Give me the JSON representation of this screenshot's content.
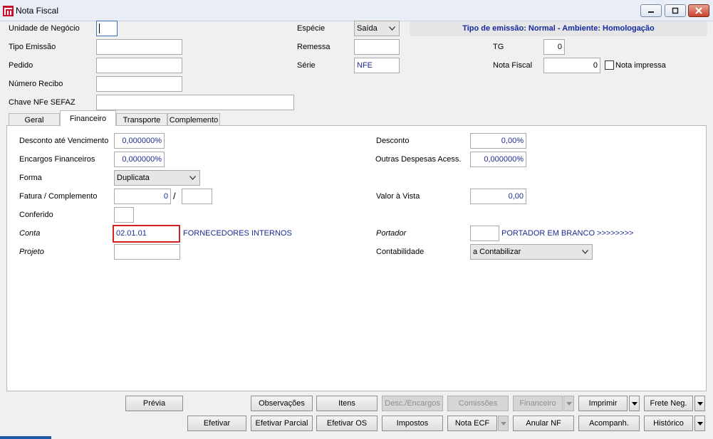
{
  "window": {
    "title": "Nota Fiscal"
  },
  "header": {
    "unidade_label": "Unidade de Negócio",
    "unidade_value": "",
    "tipo_emissao_label": "Tipo Emissão",
    "tipo_emissao_value": "",
    "pedido_label": "Pedido",
    "pedido_value": "",
    "numero_recibo_label": "Número Recibo",
    "numero_recibo_value": "",
    "chave_label": "Chave NFe SEFAZ",
    "chave_value": "",
    "especie_label": "Espécie",
    "especie_value": "Saída",
    "remessa_label": "Remessa",
    "remessa_value": "",
    "serie_label": "Série",
    "serie_value": "NFE",
    "banner": "Tipo de emissão: Normal - Ambiente: Homologação",
    "tg_label": "TG",
    "tg_value": "0",
    "nota_fiscal_label": "Nota Fiscal",
    "nota_fiscal_value": "0",
    "nota_impressa_label": "Nota impressa",
    "nota_impressa_checked": false
  },
  "tabs": [
    {
      "label": "Geral",
      "active": false
    },
    {
      "label": "Financeiro",
      "active": true
    },
    {
      "label": "Transporte",
      "active": false
    },
    {
      "label": "Complemento",
      "active": false
    }
  ],
  "financeiro": {
    "desconto_venc_label": "Desconto até Vencimento",
    "desconto_venc_value": "0,000000%",
    "encargos_label": "Encargos Financeiros",
    "encargos_value": "0,000000%",
    "forma_label": "Forma",
    "forma_value": "Duplicata",
    "fatura_label": "Fatura / Complemento",
    "fatura_value": "0",
    "fatura_sep": "/",
    "complemento_value": "",
    "conferido_label": "Conferido",
    "conferido_value": "",
    "conta_label": "Conta",
    "conta_value": "02.01.01",
    "conta_desc": "FORNECEDORES INTERNOS",
    "projeto_label": "Projeto",
    "projeto_value": "",
    "desconto_label": "Desconto",
    "desconto_value": "0,00%",
    "outras_label": "Outras Despesas Acess.",
    "outras_value": "0,000000%",
    "valor_vista_label": "Valor à Vista",
    "valor_vista_value": "0,00",
    "portador_label": "Portador",
    "portador_value": "",
    "portador_desc": "PORTADOR EM BRANCO >>>>>>>>",
    "contabilidade_label": "Contabilidade",
    "contabilidade_value": "a Contabilizar"
  },
  "buttons": {
    "previa": "Prévia",
    "observacoes": "Observações",
    "itens": "Itens",
    "desc_encargos": "Desc./Encargos",
    "comissoes": "Comissões",
    "financeiro": "Financeiro",
    "imprimir": "Imprimir",
    "frete_neg": "Frete Neg.",
    "efetivar": "Efetivar",
    "efetivar_parcial": "Efetivar Parcial",
    "efetivar_os": "Efetivar OS",
    "impostos": "Impostos",
    "nota_ecf": "Nota ECF",
    "anular_nf": "Anular NF",
    "acompanh": "Acompanh.",
    "historico": "Histórico"
  },
  "colors": {
    "banner_text": "#1428a0",
    "link_text": "#1c2b8f",
    "highlight_border": "#d42020",
    "focus_border": "#3d6fc4"
  }
}
